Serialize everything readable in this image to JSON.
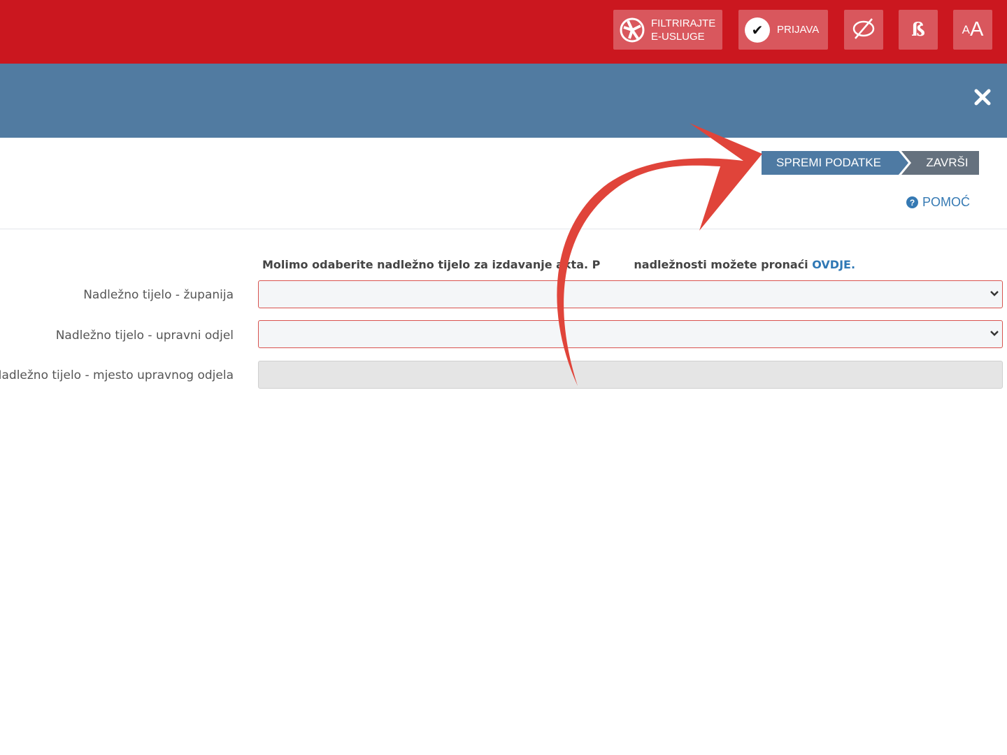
{
  "header": {
    "filter_line1": "FILTRIRAJTE",
    "filter_line2": "E-USLUGE",
    "login_label": "PRIJAVA",
    "dyslexia_label": "ß",
    "font_small": "A",
    "font_big": "A",
    "brand_color": "#cb171f"
  },
  "modal": {
    "bar_color": "#517ba1"
  },
  "steps": [
    {
      "label": "SPREMI PODATKE"
    },
    {
      "label": "ZAVRŠI"
    }
  ],
  "help": {
    "label": "POMOĆ"
  },
  "form": {
    "info_text": "Molimo odaberite nadležno tijelo za izdavanje akta. P",
    "info_text_2": "nadležnosti možete pronaći ",
    "info_link": "OVDJE.",
    "fields": [
      {
        "label": "Nadležno tijelo - županija",
        "value": ""
      },
      {
        "label": "Nadležno tijelo - upravni odjel",
        "value": ""
      },
      {
        "label": "Nadležno tijelo - mjesto upravnog odjela",
        "value": ""
      }
    ]
  },
  "annotation": {
    "arrow_color": "#e0443a"
  }
}
